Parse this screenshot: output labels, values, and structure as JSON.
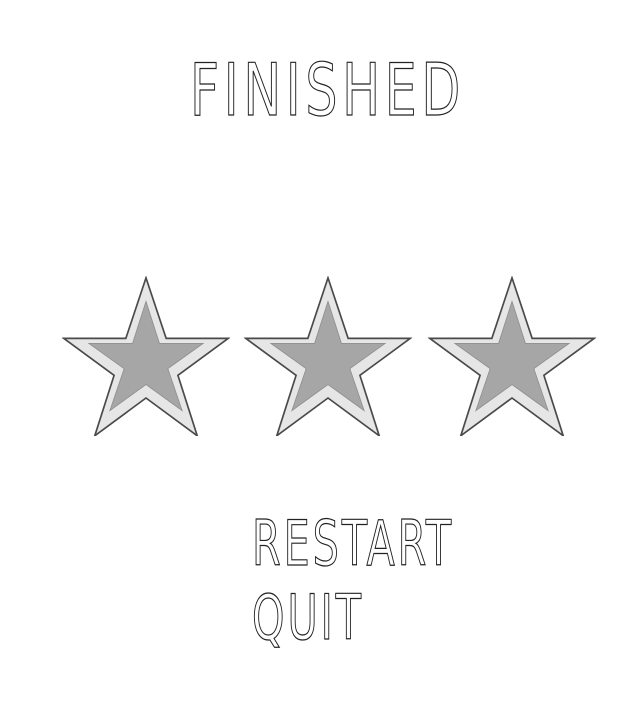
{
  "screen": {
    "title": "FINISHED",
    "stars_earned": 3,
    "stars_total": 3,
    "star_icon": "star-icon",
    "star_fill": "#a6a6a6",
    "star_edge": "#e6e6e6",
    "star_outline": "#4a4a4a"
  },
  "menu": {
    "restart_label": "RESTART",
    "quit_label": "QUIT"
  }
}
